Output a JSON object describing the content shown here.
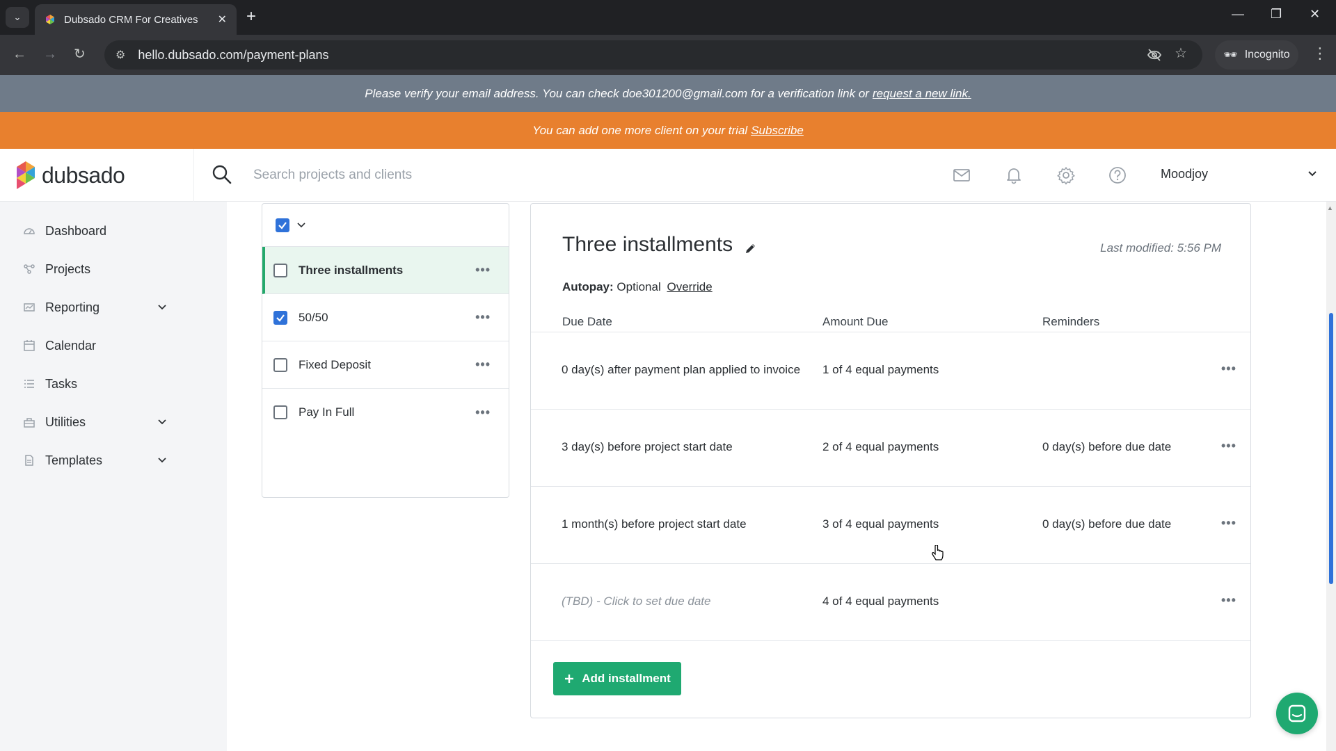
{
  "browser": {
    "tab_title": "Dubsado CRM For Creatives",
    "url": "hello.dubsado.com/payment-plans",
    "incognito_label": "Incognito"
  },
  "banners": {
    "verify_text": "Please verify your email address. You can check doe301200@gmail.com for a verification link or",
    "verify_link": "request a new link.",
    "trial_text": "You can add one more client on your trial",
    "trial_link": "Subscribe"
  },
  "header": {
    "logo_text": "dubsado",
    "search_placeholder": "Search projects and clients",
    "user_name": "Moodjoy"
  },
  "sidebar": {
    "items": [
      {
        "label": "Dashboard",
        "icon": "dashboard-icon",
        "has_chevron": false
      },
      {
        "label": "Projects",
        "icon": "projects-icon",
        "has_chevron": false
      },
      {
        "label": "Reporting",
        "icon": "reporting-icon",
        "has_chevron": true
      },
      {
        "label": "Calendar",
        "icon": "calendar-icon",
        "has_chevron": false
      },
      {
        "label": "Tasks",
        "icon": "tasks-icon",
        "has_chevron": false
      },
      {
        "label": "Utilities",
        "icon": "utilities-icon",
        "has_chevron": true
      },
      {
        "label": "Templates",
        "icon": "templates-icon",
        "has_chevron": true
      }
    ]
  },
  "plans": {
    "items": [
      {
        "name": "Three installments",
        "checked": false,
        "active": true
      },
      {
        "name": "50/50",
        "checked": true,
        "active": false
      },
      {
        "name": "Fixed Deposit",
        "checked": false,
        "active": false
      },
      {
        "name": "Pay In Full",
        "checked": false,
        "active": false
      }
    ]
  },
  "detail": {
    "title": "Three installments",
    "last_modified": "Last modified: 5:56 PM",
    "autopay_label": "Autopay:",
    "autopay_value": "Optional",
    "override_label": "Override",
    "columns": [
      "Due Date",
      "Amount Due",
      "Reminders"
    ],
    "installments": [
      {
        "due": "0 day(s) after payment plan applied to invoice",
        "amount": "1 of 4 equal payments",
        "reminder": "",
        "tbd": false
      },
      {
        "due": "3 day(s) before project start date",
        "amount": "2 of 4 equal payments",
        "reminder": "0 day(s) before due date",
        "tbd": false
      },
      {
        "due": "1 month(s) before project start date",
        "amount": "3 of 4 equal payments",
        "reminder": "0 day(s) before due date",
        "tbd": false
      },
      {
        "due": "(TBD) - Click to set due date",
        "amount": "4 of 4 equal payments",
        "reminder": "",
        "tbd": true
      }
    ],
    "add_button": "Add installment"
  },
  "colors": {
    "accent_green": "#1fa971",
    "trial_orange": "#e8802e",
    "verify_gray": "#6f7b89",
    "checkbox_blue": "#2f72d9"
  }
}
